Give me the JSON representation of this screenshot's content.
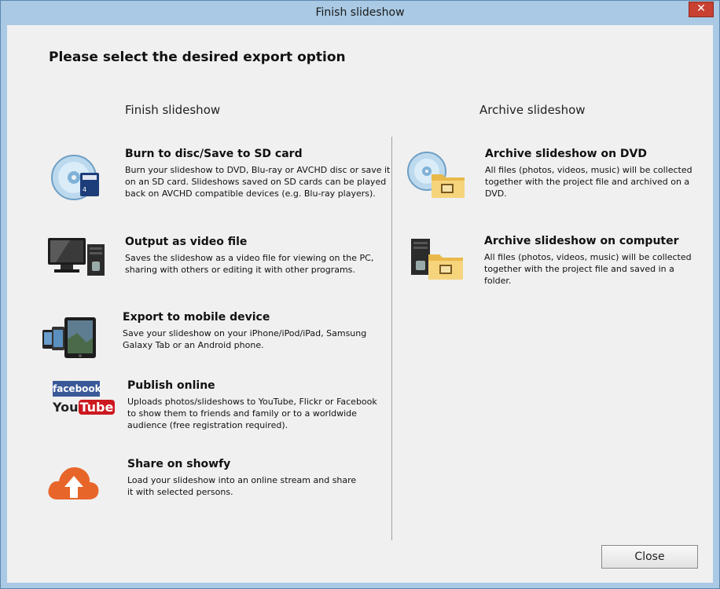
{
  "window": {
    "title": "Finish slideshow",
    "close_glyph": "✕"
  },
  "heading": "Please select the desired export option",
  "columns": {
    "left_title": "Finish slideshow",
    "right_title": "Archive slideshow"
  },
  "left_options": [
    {
      "title": "Burn to disc/Save to SD card",
      "desc": "Burn your slideshow to DVD, Blu-ray or AVCHD disc or save it\n on an SD card. Slideshows saved on SD cards can be played\nback on AVCHD compatible devices (e.g. Blu-ray players).",
      "icon": "disc-sdcard-icon"
    },
    {
      "title": "Output as video file",
      "desc": "Saves the slideshow as a video file for viewing on the PC,\nsharing with others or editing it with other programs.",
      "icon": "computer-icon"
    },
    {
      "title": "Export to mobile device",
      "desc": "Save your slideshow on your iPhone/iPod/iPad, Samsung\nGalaxy Tab or an Android phone.",
      "icon": "mobile-devices-icon"
    },
    {
      "title": "Publish online",
      "desc": "Uploads photos/slideshows to YouTube, Flickr or Facebook\nto show them to friends and family or to a worldwide\naudience (free registration required).",
      "icon": "facebook-youtube-icon",
      "logo_facebook": "facebook",
      "logo_you": "You",
      "logo_tube": "Tube"
    },
    {
      "title": "Share on showfy",
      "desc": "Load your slideshow into an online stream and share\n it with selected persons.",
      "icon": "cloud-upload-icon"
    }
  ],
  "right_options": [
    {
      "title": "Archive slideshow on DVD",
      "desc": "All files (photos, videos, music) will be collected\ntogether with the project file and archived on a\nDVD.",
      "icon": "disc-folder-icon"
    },
    {
      "title": "Archive slideshow on computer",
      "desc": "All files (photos, videos, music) will be collected\ntogether with the project file and saved in a\nfolder.",
      "icon": "tower-folder-icon"
    }
  ],
  "buttons": {
    "close_label": "Close"
  },
  "colors": {
    "frame": "#a9c9e4",
    "client": "#f0f0f0",
    "accent_orange": "#e8652a",
    "facebook": "#3b5998",
    "youtube": "#cc181e"
  }
}
